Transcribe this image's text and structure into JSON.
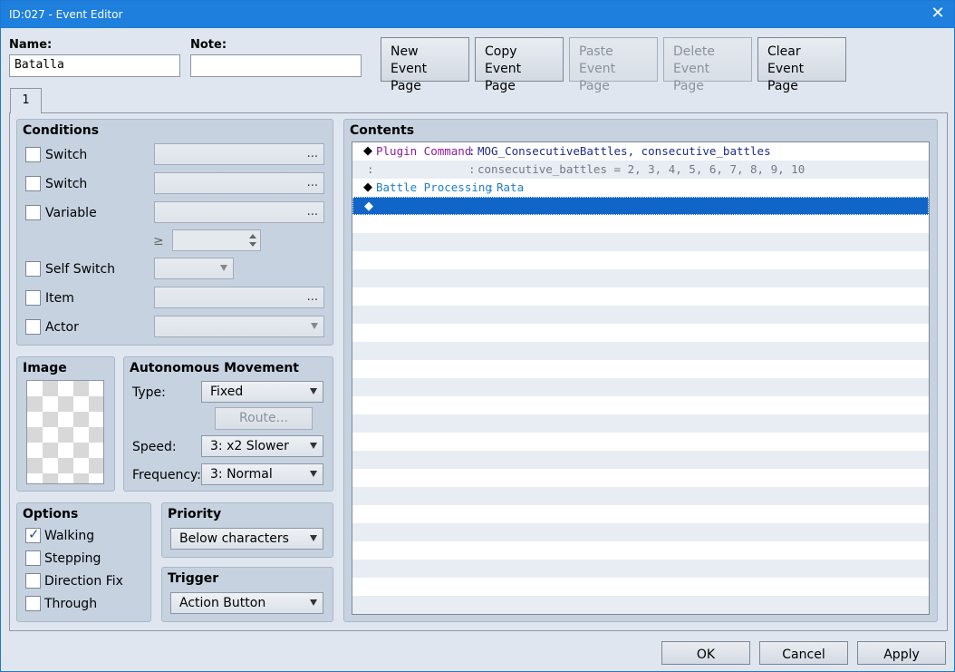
{
  "title": "ID:027 - Event Editor",
  "name": {
    "label": "Name:",
    "value": "Batalla"
  },
  "note": {
    "label": "Note:",
    "value": ""
  },
  "page_buttons": {
    "new": [
      "New",
      "Event Page"
    ],
    "copy": [
      "Copy",
      "Event Page"
    ],
    "paste": [
      "Paste",
      "Event Page"
    ],
    "delete": [
      "Delete",
      "Event Page"
    ],
    "clear": [
      "Clear",
      "Event Page"
    ]
  },
  "tab": "1",
  "conditions": {
    "title": "Conditions",
    "switch1": "Switch",
    "switch2": "Switch",
    "variable": "Variable",
    "ge": "≥",
    "self_switch": "Self Switch",
    "item": "Item",
    "actor": "Actor",
    "dots": "..."
  },
  "image": {
    "title": "Image"
  },
  "movement": {
    "title": "Autonomous Movement",
    "type_label": "Type:",
    "type_value": "Fixed",
    "route": "Route...",
    "speed_label": "Speed:",
    "speed_value": "3: x2 Slower",
    "frequency_label": "Frequency:",
    "frequency_value": "3: Normal"
  },
  "options": {
    "title": "Options",
    "walking": "Walking",
    "stepping": "Stepping",
    "direction_fix": "Direction Fix",
    "through": "Through"
  },
  "priority": {
    "title": "Priority",
    "value": "Below characters"
  },
  "trigger": {
    "title": "Trigger",
    "value": "Action Button"
  },
  "contents": {
    "title": "Contents",
    "rows": [
      {
        "cmd": "Plugin Command",
        "sep": ":",
        "value": "MOG_ConsecutiveBattles, consecutive_battles"
      },
      {
        "cmd": ":",
        "sep": ":",
        "value": "consecutive_battles = 2, 3, 4, 5, 6, 7, 8, 9, 10"
      },
      {
        "cmd": "Battle Processing",
        "sep": ":",
        "value": "Rata"
      }
    ],
    "diamond": "◆"
  },
  "footer": {
    "ok": "OK",
    "cancel": "Cancel",
    "apply": "Apply"
  }
}
